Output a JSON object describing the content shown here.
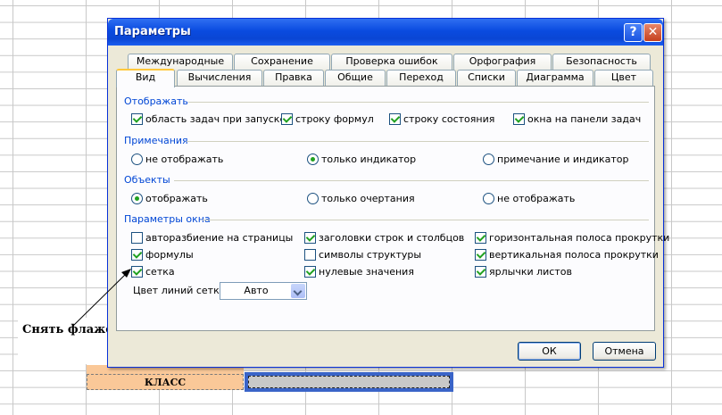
{
  "dialog": {
    "title": "Параметры",
    "help_label": "?",
    "close_label": "✕"
  },
  "tabs": {
    "row1": [
      "Международные",
      "Сохранение",
      "Проверка ошибок",
      "Орфография",
      "Безопасность"
    ],
    "row2": [
      "Вид",
      "Вычисления",
      "Правка",
      "Общие",
      "Переход",
      "Списки",
      "Диаграмма",
      "Цвет"
    ],
    "active": "Вид"
  },
  "show": {
    "label": "Отображать",
    "items": [
      {
        "label": "область задач при запуске",
        "checked": true
      },
      {
        "label": "строку формул",
        "checked": true
      },
      {
        "label": "строку состояния",
        "checked": true
      },
      {
        "label": "окна на панели задач",
        "checked": true
      }
    ]
  },
  "comments": {
    "label": "Примечания",
    "items": [
      {
        "label": "не отображать",
        "selected": false
      },
      {
        "label": "только индикатор",
        "selected": true
      },
      {
        "label": "примечание и индикатор",
        "selected": false
      }
    ]
  },
  "objects": {
    "label": "Объекты",
    "items": [
      {
        "label": "отображать",
        "selected": true
      },
      {
        "label": "только очертания",
        "selected": false
      },
      {
        "label": "не отображать",
        "selected": false
      }
    ]
  },
  "window_options": {
    "label": "Параметры окна",
    "items": [
      {
        "label": "авторазбиение на страницы",
        "checked": false
      },
      {
        "label": "заголовки строк и столбцов",
        "checked": true
      },
      {
        "label": "горизонтальная полоса прокрутки",
        "checked": true
      },
      {
        "label": "формулы",
        "checked": true
      },
      {
        "label": "символы структуры",
        "checked": false
      },
      {
        "label": "вертикальная полоса прокрутки",
        "checked": true
      },
      {
        "label": "сетка",
        "checked": true
      },
      {
        "label": "нулевые значения",
        "checked": true
      },
      {
        "label": "ярлычки листов",
        "checked": true
      }
    ],
    "gridline_color_label": "Цвет линий сетки:",
    "gridline_color_value": "Авто"
  },
  "buttons": {
    "ok": "ОК",
    "cancel": "Отмена"
  },
  "annotation": {
    "callout": "Снять флажок"
  },
  "spreadsheet": {
    "cell_text": "КЛАСС"
  },
  "colors": {
    "title_bar": "#0a4be0",
    "group_label": "#0046d5",
    "check_mark": "#21a121",
    "cell_fill": "#fac898",
    "selection": "#3a64c8"
  }
}
